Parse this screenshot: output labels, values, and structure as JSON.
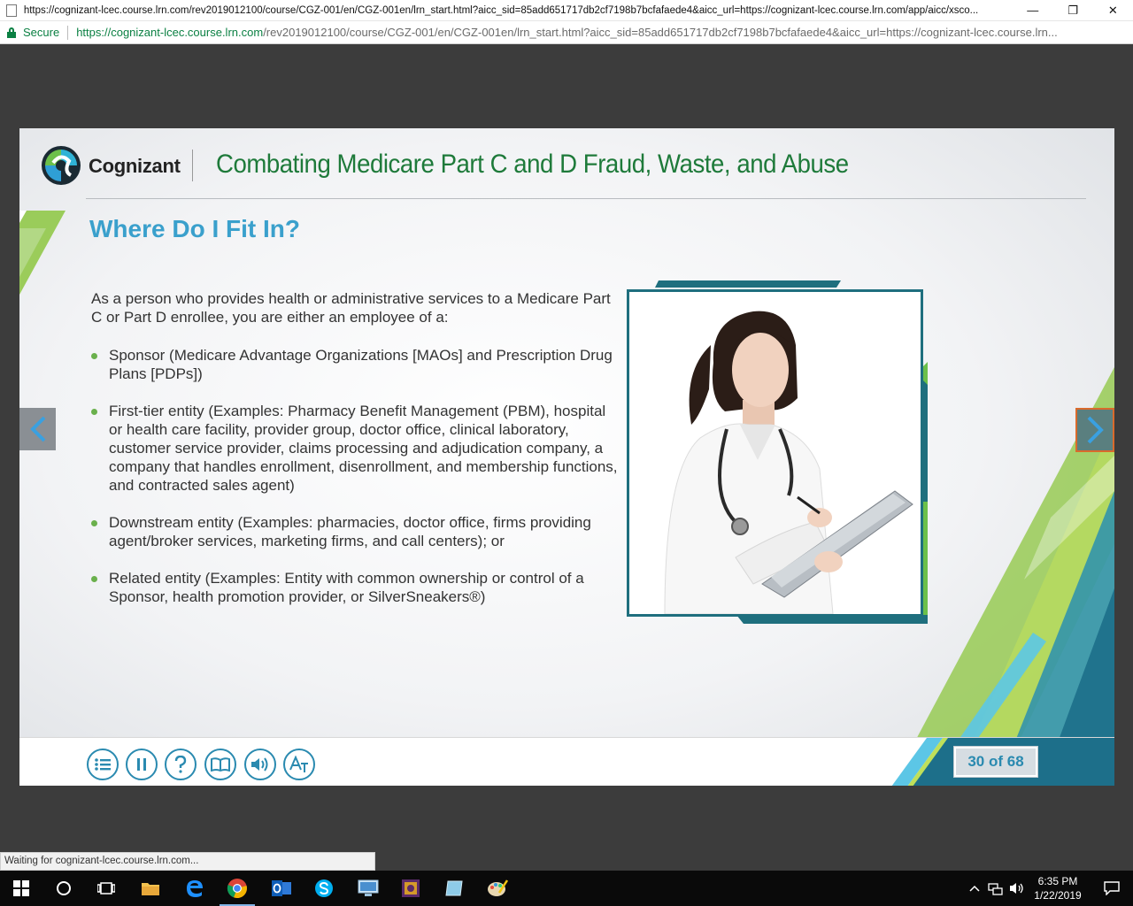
{
  "window": {
    "title": "https://cognizant-lcec.course.lrn.com/rev2019012100/course/CGZ-001/en/CGZ-001en/lrn_start.html?aicc_sid=85add651717db2cf7198b7bcfafaede4&aicc_url=https://cognizant-lcec.course.lrn.com/app/aicc/xsco...",
    "minimize": "—",
    "restore": "❐",
    "close": "✕"
  },
  "address_bar": {
    "secure_label": "Secure",
    "url_host": "https://cognizant-lcec.course.lrn.com",
    "url_rest": "/rev2019012100/course/CGZ-001/en/CGZ-001en/lrn_start.html?aicc_sid=85add651717db2cf7198b7bcfafaede4&aicc_url=https://cognizant-lcec.course.lrn..."
  },
  "slide": {
    "brand": "Cognizant",
    "course_title": "Combating Medicare Part C and D Fraud, Waste, and Abuse",
    "section_title": "Where Do I Fit In?",
    "intro": "As a person who provides health or administrative services to a Medicare Part C or Part D enrollee, you are either an employee of a:",
    "bullets": [
      "Sponsor (Medicare Advantage Organizations [MAOs] and Prescription Drug Plans [PDPs])",
      "First-tier entity (Examples: Pharmacy Benefit Management (PBM), hospital or health care facility, provider group, doctor office, clinical laboratory, customer service provider, claims processing and adjudication company, a company that handles enrollment, disenrollment, and membership functions, and contracted sales agent)",
      "Downstream entity (Examples: pharmacies, doctor office, firms providing agent/broker services, marketing firms, and call centers); or",
      "Related entity (Examples: Entity with common ownership or control of a Sponsor, health promotion provider, or SilverSneakers®)"
    ],
    "page_counter": "30 of 68"
  },
  "status_text": "Waiting for cognizant-lcec.course.lrn.com...",
  "clock": {
    "time": "6:35 PM",
    "date": "1/22/2019"
  },
  "colors": {
    "accent_blue": "#3aa0cc",
    "title_green": "#1e7a3a",
    "bullet_green": "#6ab04c",
    "frame_teal": "#1f6f7e"
  }
}
